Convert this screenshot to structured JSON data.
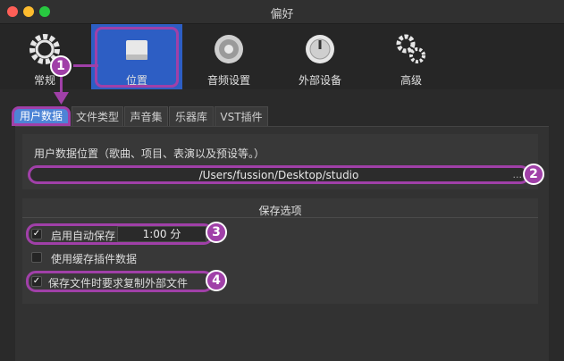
{
  "window": {
    "title": "偏好"
  },
  "toolbar": {
    "items": [
      {
        "label": "常规",
        "icon": "gear-icon"
      },
      {
        "label": "位置",
        "icon": "drive-icon"
      },
      {
        "label": "音频设置",
        "icon": "speaker-icon"
      },
      {
        "label": "外部设备",
        "icon": "dial-icon"
      },
      {
        "label": "高级",
        "icon": "gears-icon"
      }
    ],
    "selected": "位置"
  },
  "tabs": [
    {
      "label": "用户数据",
      "active": true
    },
    {
      "label": "文件类型"
    },
    {
      "label": "声音集"
    },
    {
      "label": "乐器库"
    },
    {
      "label": "VST插件"
    }
  ],
  "user_data": {
    "location_label": "用户数据位置（歌曲、项目、表演以及预设等。）",
    "path": "/Users/fussion/Desktop/studio",
    "browse": "..."
  },
  "save_options": {
    "title": "保存选项",
    "autosave": {
      "label": "启用自动保存",
      "checked": true,
      "interval": "1:00 分"
    },
    "cache_plugin": {
      "label": "使用缓存插件数据",
      "checked": false
    },
    "copy_external": {
      "label": "保存文件时要求复制外部文件",
      "checked": true
    }
  },
  "annotations": [
    "1",
    "2",
    "3",
    "4"
  ],
  "colors": {
    "highlight": "#a040a8",
    "active_tab": "#4d84d6",
    "toolbar_active": "#2d5ec4"
  }
}
